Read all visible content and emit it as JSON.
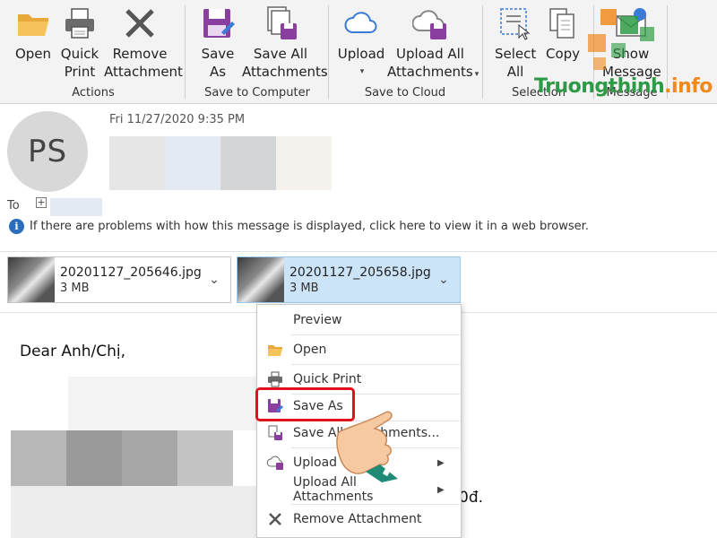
{
  "ribbon": {
    "groups": [
      {
        "label": "Actions"
      },
      {
        "label": "Save to Computer"
      },
      {
        "label": "Save to Cloud"
      },
      {
        "label": "Selection"
      },
      {
        "label": "Message"
      }
    ],
    "buttons": {
      "open": {
        "line1": "Open",
        "line2": ""
      },
      "quick_print": {
        "line1": "Quick",
        "line2": "Print"
      },
      "remove_attachment": {
        "line1": "Remove",
        "line2": "Attachment"
      },
      "save_as": {
        "line1": "Save",
        "line2": "As"
      },
      "save_all": {
        "line1": "Save All",
        "line2": "Attachments"
      },
      "upload": {
        "line1": "Upload",
        "line2": "▾"
      },
      "upload_all": {
        "line1": "Upload All",
        "line2": "Attachments"
      },
      "select_all": {
        "line1": "Select",
        "line2": "All"
      },
      "copy": {
        "line1": "Copy",
        "line2": ""
      },
      "show_message": {
        "line1": "Show",
        "line2": "Message"
      }
    }
  },
  "message": {
    "avatar_initials": "PS",
    "date": "Fri 11/27/2020 9:35 PM",
    "to_label": "To",
    "info_text": "If there are problems with how this message is displayed, click here to view it in a web browser.",
    "greeting": "Dear Anh/Chị,",
    "body_tail": "0đ."
  },
  "attachments": [
    {
      "name": "20201127_205646.jpg",
      "size": "3 MB"
    },
    {
      "name": "20201127_205658.jpg",
      "size": "3 MB"
    }
  ],
  "context_menu": {
    "items": [
      {
        "label": "Preview",
        "icon": "none"
      },
      {
        "label": "Open",
        "icon": "folder-icon"
      },
      {
        "label": "Quick Print",
        "icon": "printer-icon"
      },
      {
        "label": "Save As",
        "icon": "save-as-icon"
      },
      {
        "label": "Save All Attachments...",
        "icon": "save-all-icon"
      },
      {
        "label": "Upload",
        "icon": "cloud-upload-icon"
      },
      {
        "label": "Upload All Attachments",
        "icon": "none"
      },
      {
        "label": "Remove Attachment",
        "icon": "close-icon"
      }
    ]
  },
  "watermark": {
    "main": "Truongthinh",
    "suffix": ".info"
  },
  "colors": {
    "ribbon_bg": "#f3f3f3",
    "accent_purple": "#8a3fa0",
    "highlight_red": "#e0101c",
    "selected_attachment": "#cce4f7",
    "watermark_green": "#2d9b45",
    "watermark_orange": "#f08a1d"
  }
}
